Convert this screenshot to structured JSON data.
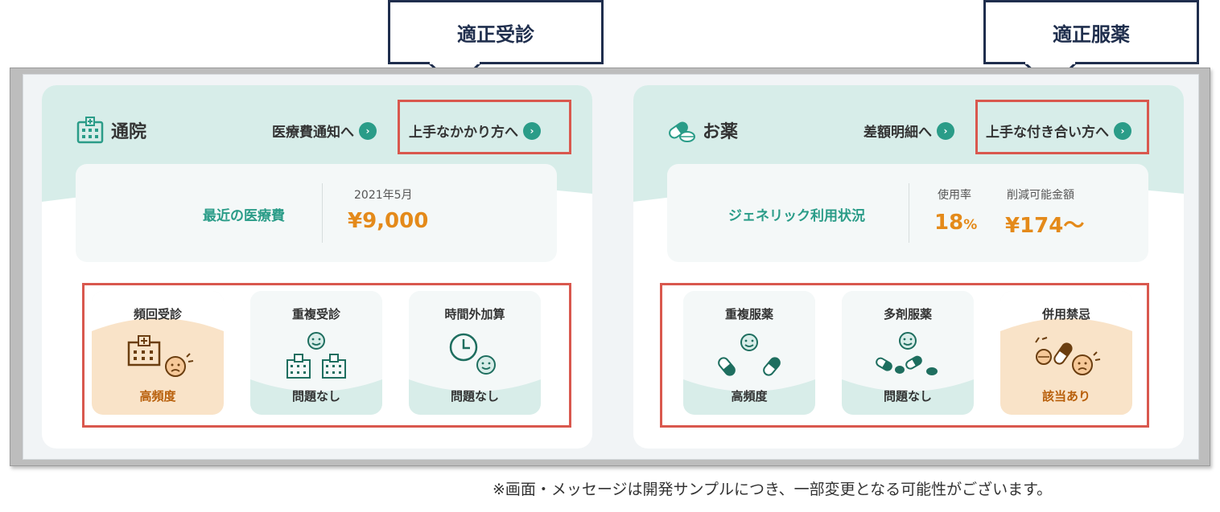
{
  "callouts": {
    "left": "適正受診",
    "right": "適正服薬"
  },
  "clinic": {
    "title": "通院",
    "icon": "hospital-icon",
    "link1": "医療費通知へ",
    "link2": "上手なかかり方へ",
    "summary": {
      "label": "最近の医療費",
      "month": "2021年5月",
      "amount": "¥9,000"
    },
    "tiles": [
      {
        "title": "頻回受診",
        "status": "高頻度",
        "icon": "hospital-sad-face-icon",
        "state": "warning"
      },
      {
        "title": "重複受診",
        "status": "問題なし",
        "icon": "two-hospitals-smile-icon",
        "state": "ok"
      },
      {
        "title": "時間外加算",
        "status": "問題なし",
        "icon": "clock-smile-icon",
        "state": "ok"
      }
    ]
  },
  "medicine": {
    "title": "お薬",
    "icon": "pills-icon",
    "link1": "差額明細へ",
    "link2": "上手な付き合い方へ",
    "summary": {
      "label": "ジェネリック利用状況",
      "usage_label": "使用率",
      "usage_value": "18",
      "usage_unit": "%",
      "savings_label": "削減可能金額",
      "savings_value": "¥174〜"
    },
    "tiles": [
      {
        "title": "重複服薬",
        "status": "高頻度",
        "icon": "capsules-smile-icon",
        "state": "ok"
      },
      {
        "title": "多剤服薬",
        "status": "問題なし",
        "icon": "many-pills-smile-icon",
        "state": "ok"
      },
      {
        "title": "併用禁忌",
        "status": "該当あり",
        "icon": "pills-sad-face-icon",
        "state": "warning"
      }
    ]
  },
  "footnote": "※画面・メッセージは開発サンプルにつき、一部変更となる可能性がございます。",
  "colors": {
    "accent": "#2a9c88",
    "amount": "#e48a1a",
    "warning_bg": "#f9e3c8",
    "ok_bg": "#d8ede9",
    "highlight": "#d9584e",
    "callout": "#1f2e4d"
  }
}
